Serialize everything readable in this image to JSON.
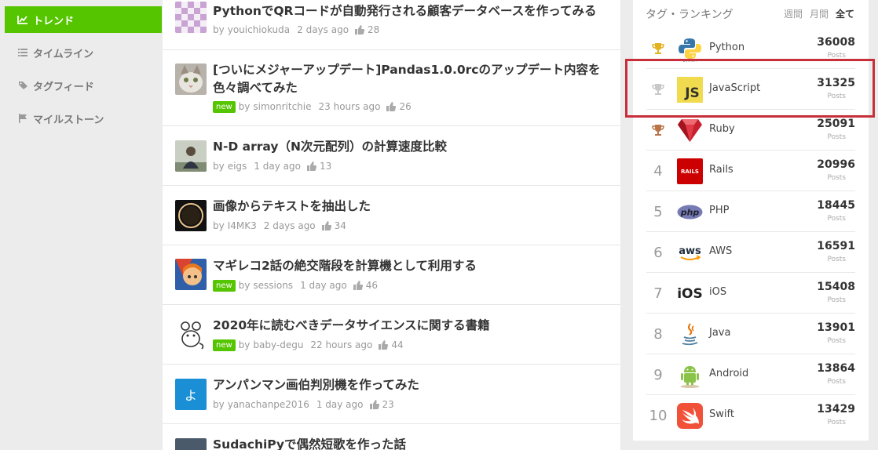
{
  "nav": [
    {
      "label": "トレンド",
      "icon": "trend-icon",
      "active": true
    },
    {
      "label": "タイムライン",
      "icon": "list-icon"
    },
    {
      "label": "タグフィード",
      "icon": "tag-icon"
    },
    {
      "label": "マイルストーン",
      "icon": "flag-icon"
    }
  ],
  "feed": [
    {
      "title": "PythonでQRコードが自動発行される顧客データベースを作ってみる",
      "by": "by",
      "user": "youichiokuda",
      "date": "2 days ago",
      "likes": "28",
      "new": ""
    },
    {
      "title": "[ついにメジャーアップデート]Pandas1.0.0rcのアップデート内容を色々調べてみた",
      "by": "by",
      "user": "simonritchie",
      "date": "23 hours ago",
      "likes": "26",
      "new": "new"
    },
    {
      "title": "N-D array（N次元配列）の計算速度比較",
      "by": "by",
      "user": "eigs",
      "date": "1 day ago",
      "likes": "13",
      "new": ""
    },
    {
      "title": "画像からテキストを抽出した",
      "by": "by",
      "user": "I4MK3",
      "date": "2 days ago",
      "likes": "34",
      "new": ""
    },
    {
      "title": "マギレコ2話の絶交階段を計算機として利用する",
      "by": "by",
      "user": "sessions",
      "date": "1 day ago",
      "likes": "46",
      "new": "new"
    },
    {
      "title": "2020年に読むべきデータサイエンスに関する書籍",
      "by": "by",
      "user": "baby-degu",
      "date": "22 hours ago",
      "likes": "44",
      "new": "new"
    },
    {
      "title": "アンパンマン画伯判別機を作ってみた",
      "by": "by",
      "user": "yanachanpe2016",
      "date": "1 day ago",
      "likes": "23",
      "new": "",
      "thumb_char": "よ"
    },
    {
      "title": "SudachiPyで偶然短歌を作った話",
      "by": "",
      "user": "",
      "date": "",
      "likes": "",
      "new": ""
    }
  ],
  "ranking": {
    "title": "タグ・ランキング",
    "periods": [
      "週間",
      "月間",
      "全て"
    ],
    "unit": "Posts",
    "rows": [
      {
        "rank": "",
        "name": "Python",
        "count": "36008",
        "logo": "python-logo",
        "trophy": "gold-trophy-icon",
        "logo_text": "python"
      },
      {
        "rank": "",
        "name": "JavaScript",
        "count": "31325",
        "logo": "javascript-logo",
        "trophy": "silver-trophy-icon",
        "logo_text": "JS"
      },
      {
        "rank": "",
        "name": "Ruby",
        "count": "25091",
        "logo": "ruby-logo",
        "trophy": "bronze-trophy-icon"
      },
      {
        "rank": "4",
        "name": "Rails",
        "count": "20996",
        "logo": "rails-logo",
        "logo_text": "RAILS"
      },
      {
        "rank": "5",
        "name": "PHP",
        "count": "18445",
        "logo": "php-logo",
        "logo_text": "php"
      },
      {
        "rank": "6",
        "name": "AWS",
        "count": "16591",
        "logo": "aws-logo",
        "logo_text": "aws"
      },
      {
        "rank": "7",
        "name": "iOS",
        "count": "15408",
        "logo": "ios-logo",
        "logo_text": "iOS"
      },
      {
        "rank": "8",
        "name": "Java",
        "count": "13901",
        "logo": "java-logo"
      },
      {
        "rank": "9",
        "name": "Android",
        "count": "13864",
        "logo": "android-logo"
      },
      {
        "rank": "10",
        "name": "Swift",
        "count": "13429",
        "logo": "swift-logo"
      }
    ]
  },
  "colors": {
    "accent": "#55c500",
    "highlight": "#c7303a"
  }
}
